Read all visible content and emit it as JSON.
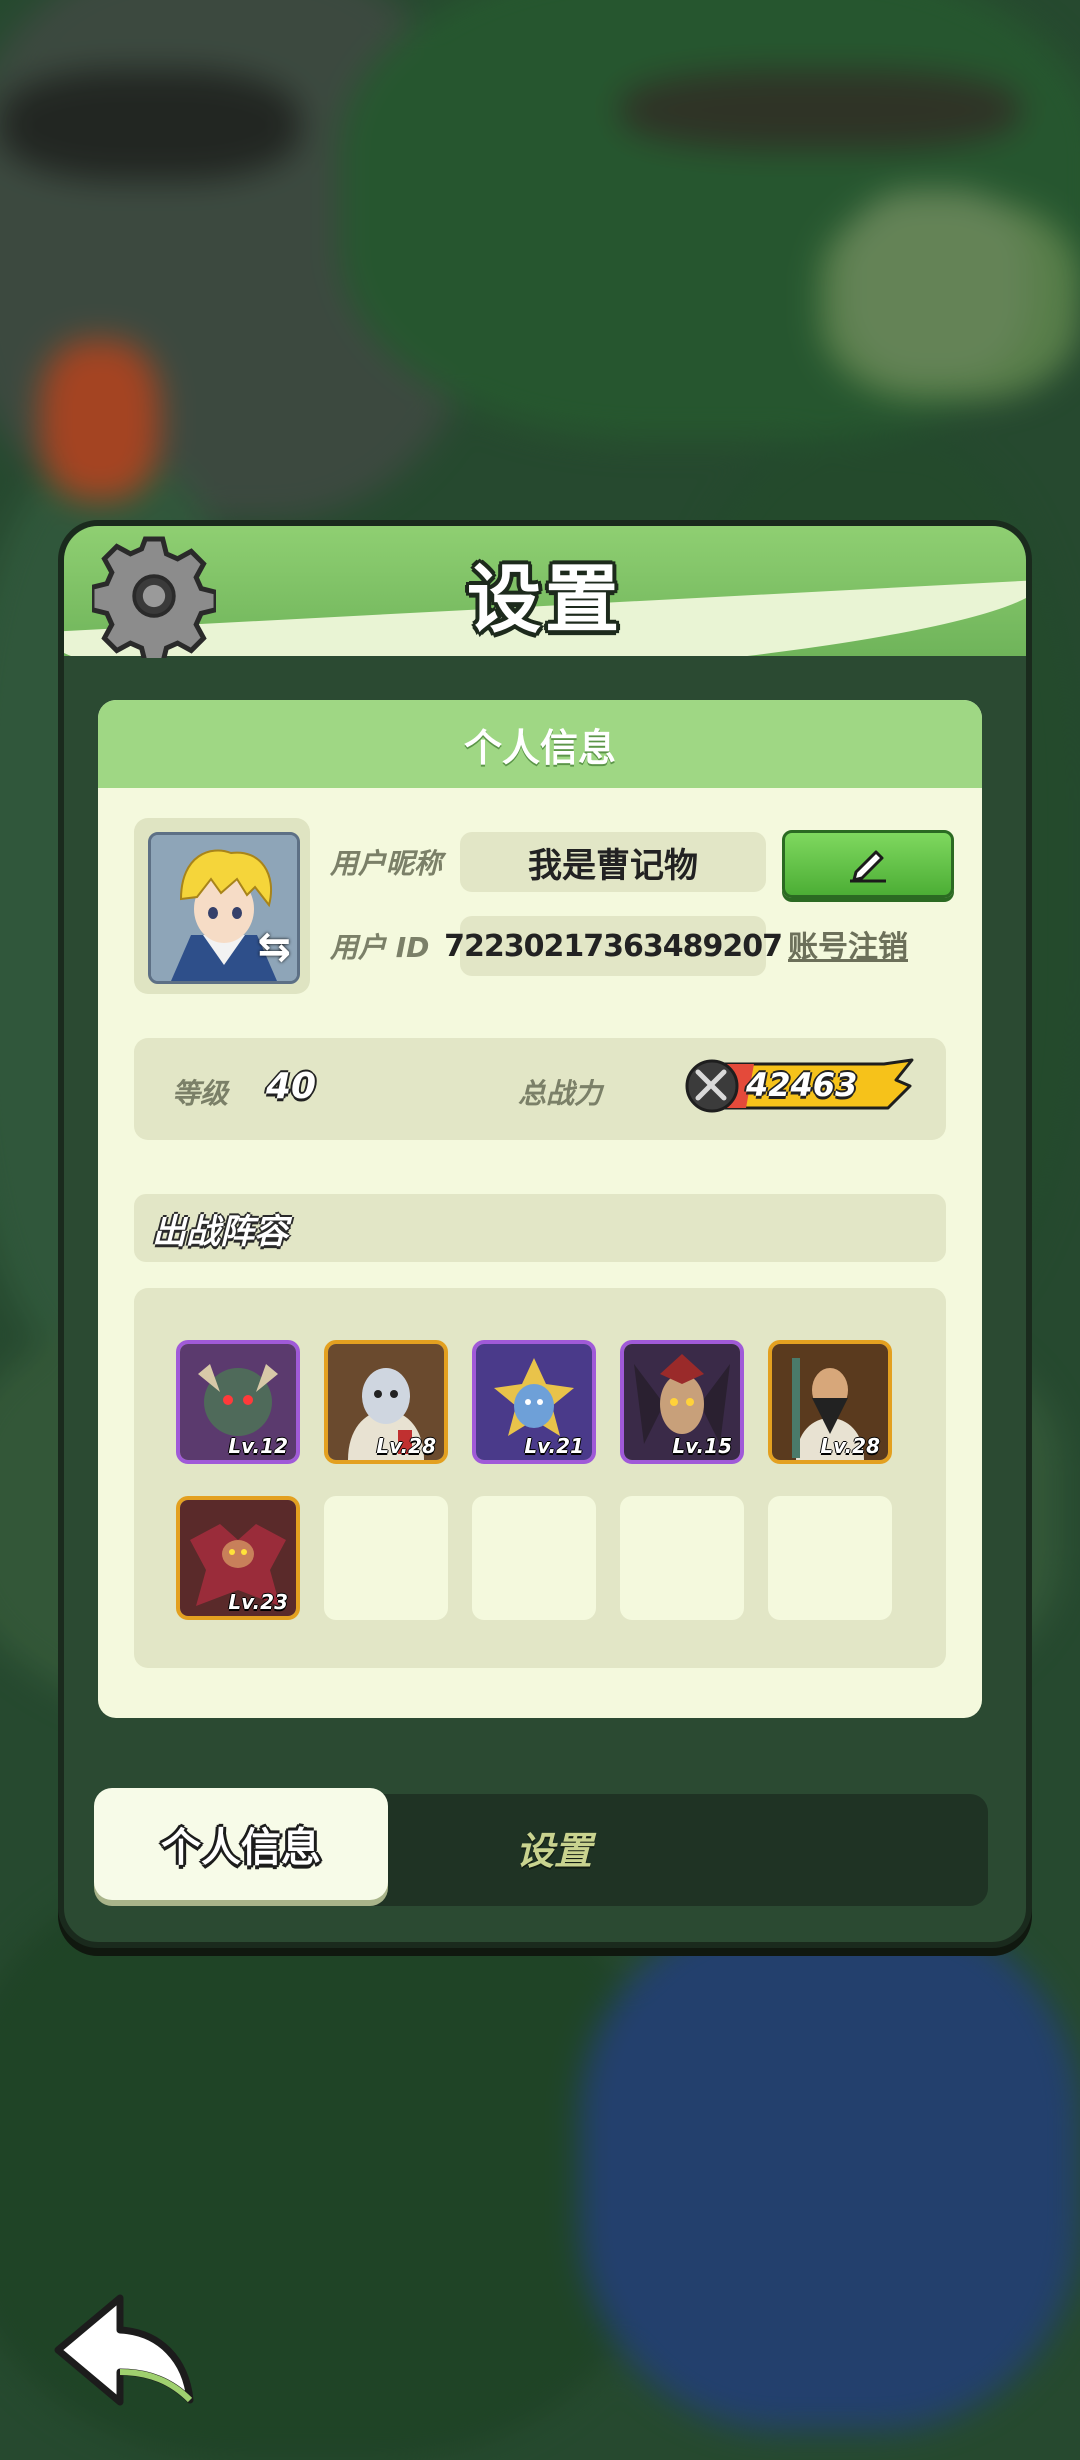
{
  "panel": {
    "title": "设置",
    "icon": "gear-icon"
  },
  "profile": {
    "section_title": "个人信息",
    "nickname_label": "用户昵称",
    "nickname": "我是曹记物",
    "id_label": "用户 ID",
    "user_id": "72230217363489207",
    "deregister_label": "账号注销",
    "edit_icon": "pencil-icon",
    "level_label": "等级",
    "level": "40",
    "power_label": "总战力",
    "power": "42463"
  },
  "lineup": {
    "title": "出战阵容",
    "heroes": [
      {
        "level": "Lv.12",
        "rarity": "epic",
        "frame_color": "#a05ad8"
      },
      {
        "level": "Lv.28",
        "rarity": "legendary",
        "frame_color": "#e3a020"
      },
      {
        "level": "Lv.21",
        "rarity": "epic",
        "frame_color": "#a05ad8"
      },
      {
        "level": "Lv.15",
        "rarity": "epic",
        "frame_color": "#a05ad8"
      },
      {
        "level": "Lv.28",
        "rarity": "legendary",
        "frame_color": "#e3a020"
      },
      {
        "level": "Lv.23",
        "rarity": "legendary",
        "frame_color": "#e3a020"
      }
    ],
    "empty_slots": 4
  },
  "tabs": {
    "personal": "个人信息",
    "settings": "设置",
    "active": "personal"
  },
  "colors": {
    "panel_green": "#8fcf72",
    "card_bg": "#f4f9dd",
    "accent_green": "#4cae35",
    "power_yellow": "#f6c21a"
  }
}
